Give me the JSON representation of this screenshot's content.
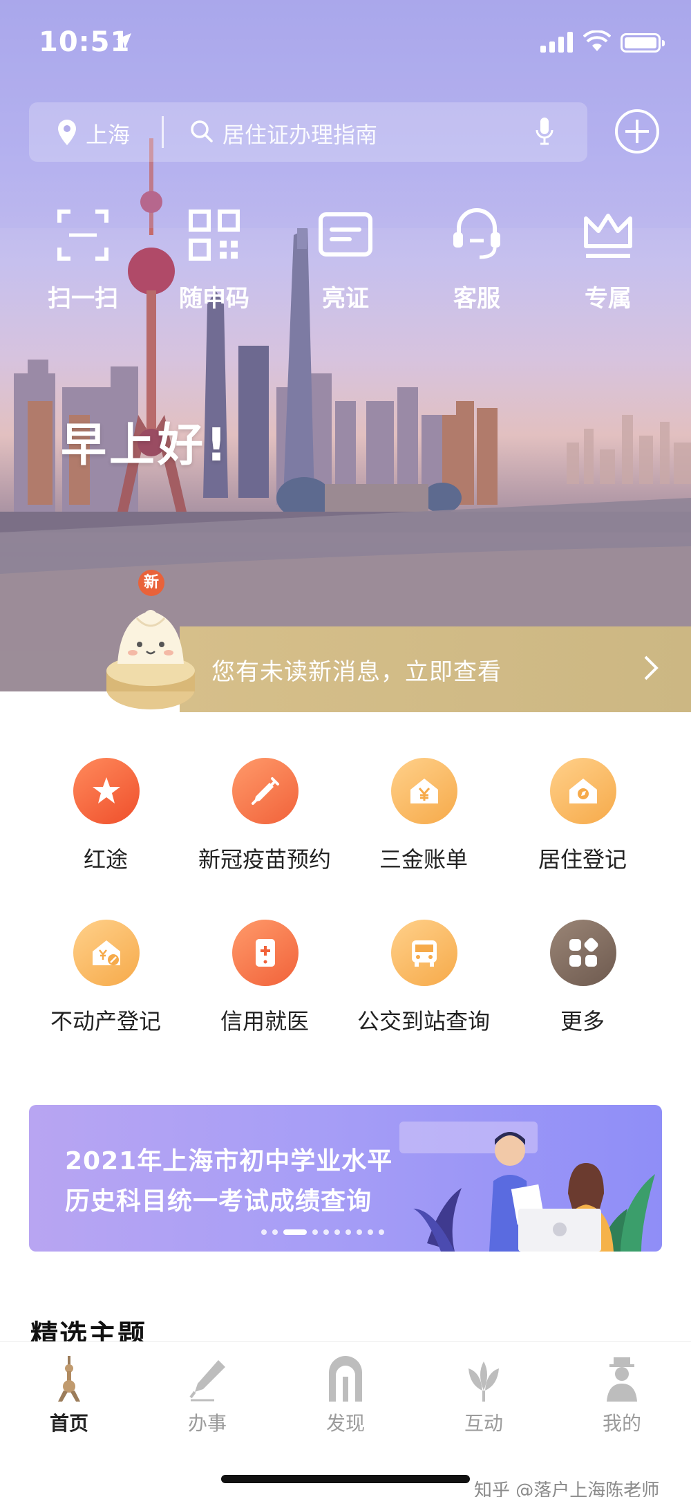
{
  "status_bar": {
    "time": "10:51"
  },
  "search": {
    "city": "上海",
    "placeholder": "居住证办理指南"
  },
  "quick_actions": [
    {
      "label": "扫一扫",
      "icon": "scan-icon"
    },
    {
      "label": "随申码",
      "icon": "qr-code-icon"
    },
    {
      "label": "亮证",
      "icon": "id-card-icon"
    },
    {
      "label": "客服",
      "icon": "customer-service-icon"
    },
    {
      "label": "专属",
      "icon": "crown-icon"
    }
  ],
  "greeting": "早上好!",
  "notice": {
    "badge": "新",
    "text": "您有未读新消息，立即查看"
  },
  "services": [
    {
      "label": "红途",
      "icon": "red-star-icon",
      "color": "#ef4f2b"
    },
    {
      "label": "新冠疫苗预约",
      "icon": "syringe-icon",
      "color": "#f1623a"
    },
    {
      "label": "三金账单",
      "icon": "house-yen-icon",
      "color": "#f6aa4a"
    },
    {
      "label": "居住登记",
      "icon": "house-compass-icon",
      "color": "#f6aa4a"
    },
    {
      "label": "不动产登记",
      "icon": "property-icon",
      "color": "#f6aa4a"
    },
    {
      "label": "信用就医",
      "icon": "medical-phone-icon",
      "color": "#f1623a"
    },
    {
      "label": "公交到站查询",
      "icon": "bus-icon",
      "color": "#f6aa4a"
    },
    {
      "label": "更多",
      "icon": "more-grid-icon",
      "color": "#6e5a4f"
    }
  ],
  "banner": {
    "line1": "2021年上海市初中学业水平",
    "line2": "历史科目统一考试成绩查询",
    "active_slide": 2,
    "slide_count": 10
  },
  "section": {
    "title": "精选主题"
  },
  "tabs": [
    {
      "label": "首页",
      "icon": "tower-icon",
      "active": true
    },
    {
      "label": "办事",
      "icon": "pen-icon",
      "active": false
    },
    {
      "label": "发现",
      "icon": "gate-icon",
      "active": false
    },
    {
      "label": "互动",
      "icon": "magnolia-icon",
      "active": false
    },
    {
      "label": "我的",
      "icon": "person-icon",
      "active": false
    }
  ],
  "watermark": "知乎 @落户上海陈老师"
}
